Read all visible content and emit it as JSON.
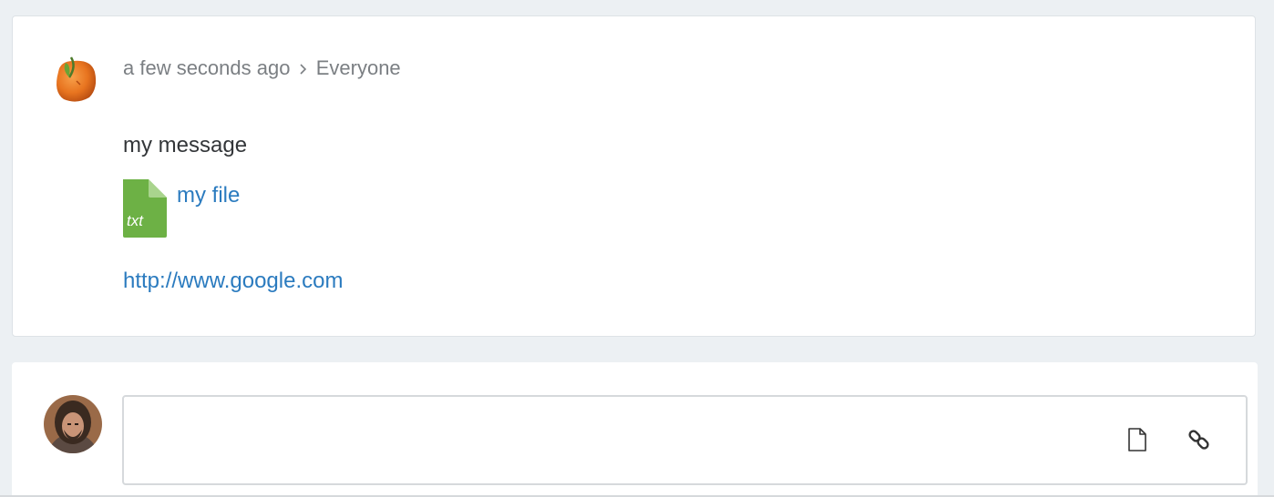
{
  "post": {
    "timestamp": "a few seconds ago",
    "audience": "Everyone",
    "message": "my message",
    "attachment": {
      "extension": "txt",
      "name": "my file",
      "icon": "file-icon",
      "color": "#6db145"
    },
    "link": "http://www.google.com"
  },
  "composer": {
    "placeholder": "",
    "tools": [
      {
        "icon": "attach-file-icon"
      },
      {
        "icon": "link-icon"
      }
    ]
  },
  "colors": {
    "link": "#2b7bbf",
    "meta": "#7b7f83",
    "background": "#ecf0f3"
  }
}
